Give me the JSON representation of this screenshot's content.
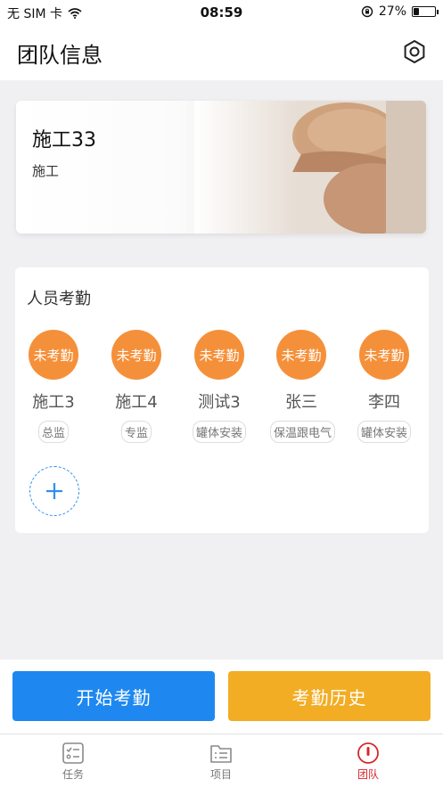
{
  "status_bar": {
    "carrier": "无 SIM 卡",
    "time": "08:59",
    "battery_percent": "27%",
    "battery_level": 0.27
  },
  "header": {
    "title": "团队信息",
    "settings_icon": "settings-icon"
  },
  "banner": {
    "title": "施工33",
    "subtitle": "施工"
  },
  "attendance": {
    "title": "人员考勤",
    "members": [
      {
        "status": "未考勤",
        "name": "施工3",
        "role": "总监"
      },
      {
        "status": "未考勤",
        "name": "施工4",
        "role": "专监"
      },
      {
        "status": "未考勤",
        "name": "测试3",
        "role": "罐体安装"
      },
      {
        "status": "未考勤",
        "name": "张三",
        "role": "保温跟电气"
      },
      {
        "status": "未考勤",
        "name": "李四",
        "role": "罐体安装"
      }
    ],
    "add_icon": "plus-icon"
  },
  "actions": {
    "start_label": "开始考勤",
    "history_label": "考勤历史"
  },
  "tabs": [
    {
      "label": "任务",
      "icon": "task-icon",
      "active": false
    },
    {
      "label": "项目",
      "icon": "project-icon",
      "active": false
    },
    {
      "label": "团队",
      "icon": "team-icon",
      "active": true
    }
  ],
  "colors": {
    "badge": "#f5903a",
    "primary": "#1e88f0",
    "secondary": "#f2ad24",
    "active_tab": "#d9262a"
  }
}
